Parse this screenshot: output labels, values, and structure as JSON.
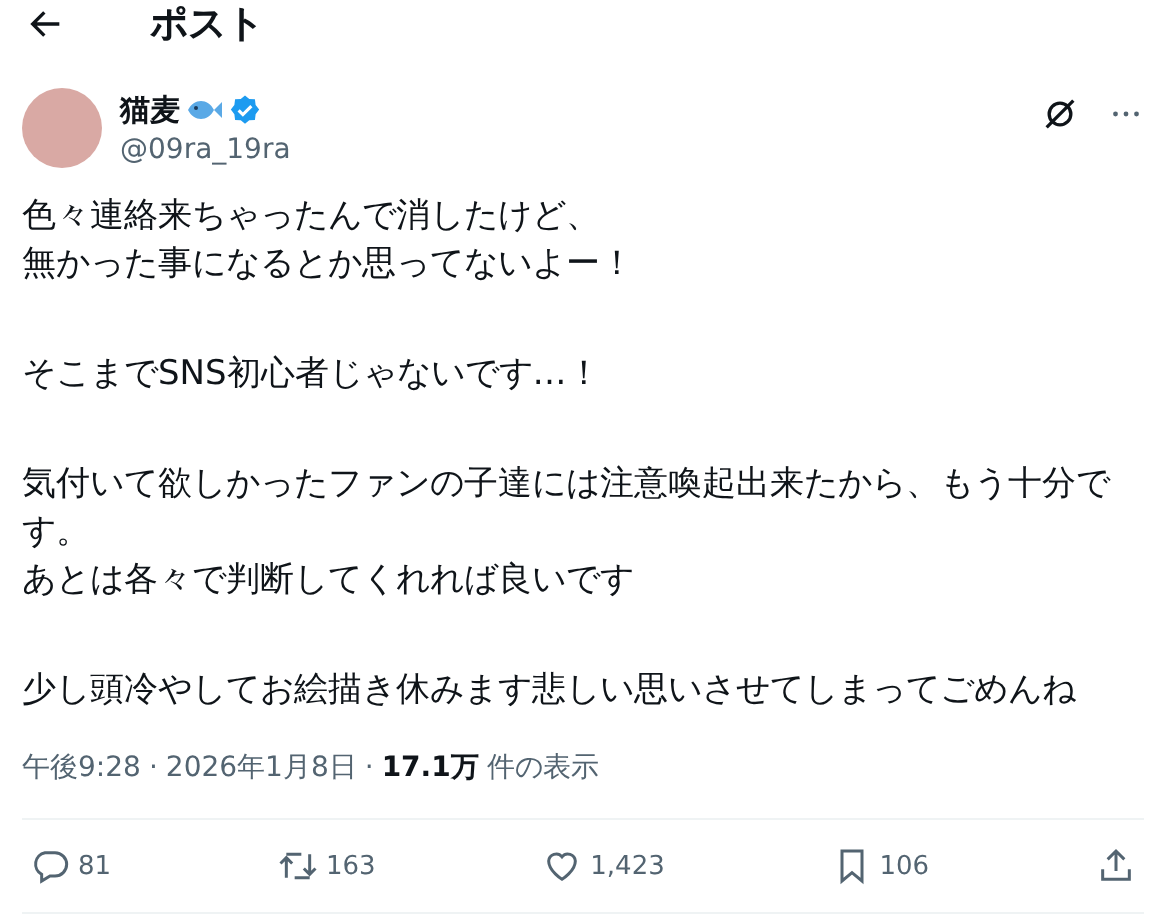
{
  "header": {
    "title": "ポスト"
  },
  "author": {
    "name": "猫麦",
    "handle": "@09ra_19ra"
  },
  "body": [
    {
      "lines": [
        "色々連絡来ちゃったんで消したけど、",
        "無かった事になるとか思ってないよー！"
      ]
    },
    {
      "lines": [
        "そこまでSNS初心者じゃないです…！"
      ]
    },
    {
      "lines": [
        "気付いて欲しかったファンの子達には注意喚起出来たから、もう十分です。",
        "あとは各々で判断してくれれば良いです"
      ]
    },
    {
      "lines": [
        "少し頭冷やしてお絵描き休みます悲しい思いさせてしまってごめんね"
      ]
    }
  ],
  "meta": {
    "time": "午後9:28",
    "separator": "·",
    "date": "2026年1月8日",
    "views": "17.1万",
    "views_label": "件の表示"
  },
  "actions": [
    {
      "kind": "reply",
      "count": "81"
    },
    {
      "kind": "repost",
      "count": "163"
    },
    {
      "kind": "like",
      "count": "1,423"
    },
    {
      "kind": "bookmark",
      "count": "106"
    },
    {
      "kind": "share"
    }
  ]
}
